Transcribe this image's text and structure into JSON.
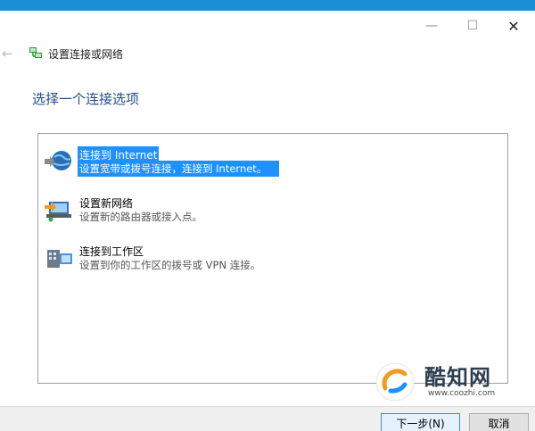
{
  "window": {
    "title": "设置连接或网络",
    "minimize_glyph": "—",
    "maximize_glyph": "☐",
    "close_glyph": "✕",
    "back_glyph": "←"
  },
  "page": {
    "heading": "选择一个连接选项"
  },
  "options": [
    {
      "title": "连接到 Internet",
      "desc": "设置宽带或拨号连接，连接到 Internet。",
      "icon": "globe-icon",
      "selected": true
    },
    {
      "title": "设置新网络",
      "desc": "设置新的路由器或接入点。",
      "icon": "router-icon",
      "selected": false
    },
    {
      "title": "连接到工作区",
      "desc": "设置到你的工作区的拨号或 VPN 连接。",
      "icon": "workplace-icon",
      "selected": false
    }
  ],
  "footer": {
    "next_label": "下一步(N)",
    "cancel_label": "取消"
  },
  "watermark": {
    "brand": "酷知网",
    "url": "www.coozhi.com"
  },
  "colors": {
    "accent": "#1e90ff",
    "heading": "#1f4e8c",
    "frame": "#1a8fd8"
  }
}
